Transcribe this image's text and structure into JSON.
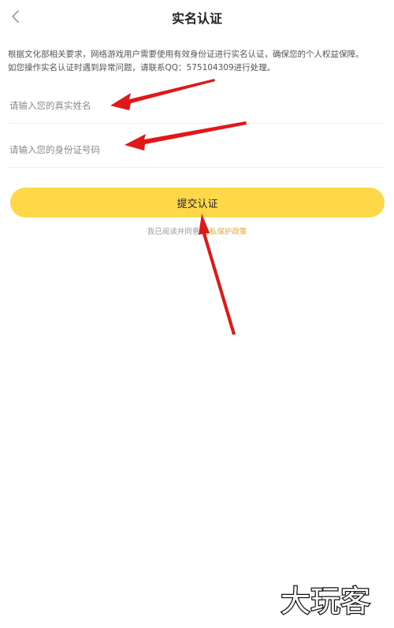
{
  "header": {
    "title": "实名认证",
    "back_icon": "chevron-left-icon"
  },
  "notice": {
    "line1": "根据文化部相关要求，网络游戏用户需要使用有效身份证进行实名认证，确保您的个人权益保障。",
    "line2": "如您操作实名认证时遇到异常问题，请联系QQ：575104309进行处理。"
  },
  "form": {
    "name_placeholder": "请输入您的真实姓名",
    "id_placeholder": "请输入您的身份证号码",
    "name_value": "",
    "id_value": ""
  },
  "submit": {
    "label": "提交认证"
  },
  "agreement": {
    "prefix": "我已阅读并同意",
    "link": "隐私保护政策"
  },
  "watermark": {
    "text": "大玩客"
  },
  "colors": {
    "accent_yellow": "#ffd84a",
    "link_orange": "#f5a623",
    "arrow_red": "#e01818"
  }
}
